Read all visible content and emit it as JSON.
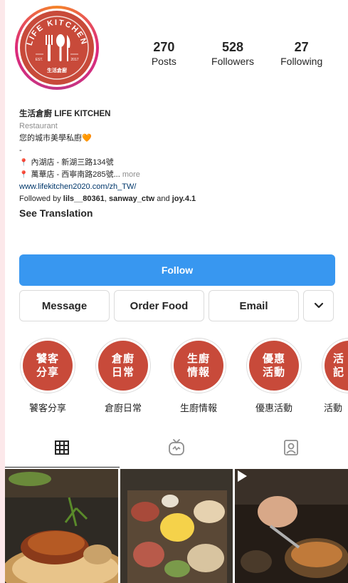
{
  "profile": {
    "avatar_logo": "LIFE KITCHEN",
    "avatar_est": "EST.",
    "avatar_year": "2017",
    "avatar_chinese": "生活倉廚"
  },
  "stats": [
    {
      "value": "270",
      "label": "Posts"
    },
    {
      "value": "528",
      "label": "Followers"
    },
    {
      "value": "27",
      "label": "Following"
    }
  ],
  "bio": {
    "name": "生活倉廚 LIFE KITCHEN",
    "category": "Restaurant",
    "tagline": "您的城市美學私廚🧡",
    "dash": "-",
    "location_1": "內湖店 - 新湖三路134號",
    "location_2": "萬華店 - 西寧南路285號...",
    "more": "more",
    "website": "www.lifekitchen2020.com/zh_TW/",
    "followed_prefix": "Followed by ",
    "followed_user_1": "lils__80361",
    "followed_sep": ", ",
    "followed_user_2": "sanway_ctw",
    "followed_and": " and ",
    "followed_user_3": "joy.4.1",
    "see_translation": "See Translation"
  },
  "buttons": {
    "follow": "Follow",
    "message": "Message",
    "order_food": "Order Food",
    "email": "Email"
  },
  "highlights": [
    {
      "line1": "饕客",
      "line2": "分享",
      "label": "饕客分享"
    },
    {
      "line1": "倉廚",
      "line2": "日常",
      "label": "倉廚日常"
    },
    {
      "line1": "生廚",
      "line2": "情報",
      "label": "生廚情報"
    },
    {
      "line1": "優惠",
      "line2": "活動",
      "label": "優惠活動"
    },
    {
      "line1": "活",
      "line2": "記",
      "label": "活動"
    }
  ],
  "tabs": [
    {
      "icon": "grid-icon",
      "active": true
    },
    {
      "icon": "igtv-icon",
      "active": false
    },
    {
      "icon": "tagged-icon",
      "active": false
    }
  ],
  "colors": {
    "brand": "#c84a3a",
    "follow_button": "#3897f0",
    "page_border": "#fce8ea"
  }
}
